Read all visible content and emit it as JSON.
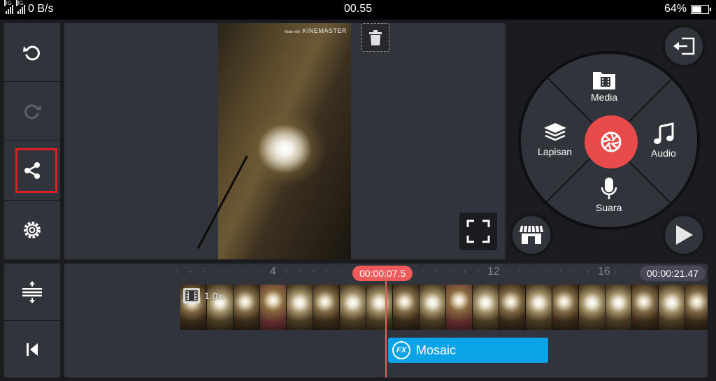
{
  "status_bar": {
    "network_1": "4G",
    "network_2": "3G",
    "speed": "0 B/s",
    "time": "00.55",
    "battery": "64%",
    "battery_level": 0.64
  },
  "left_toolbar": {
    "icons": [
      "undo-icon",
      "redo-icon",
      "share-icon",
      "settings-icon"
    ],
    "highlighted": "share"
  },
  "timeline_tools": {
    "icons": [
      "expand-timeline-icon",
      "skip-to-start-icon"
    ]
  },
  "preview": {
    "watermark_prefix": "Made with",
    "watermark_brand": "KINEMASTER",
    "icons": [
      "trash-icon",
      "fullscreen-icon"
    ]
  },
  "media_wheel": {
    "items": {
      "media": "Media",
      "layer": "Lapisan",
      "audio": "Audio",
      "voice": "Suara"
    },
    "center": "camera-shutter-icon",
    "colors": {
      "record": "#e94b4b",
      "accent_fx": "#0aa3e8"
    }
  },
  "right_controls": {
    "icons": [
      "exit-project-icon",
      "asset-store-icon",
      "play-icon"
    ]
  },
  "timeline": {
    "ruler_labels": [
      "4",
      "12",
      "16"
    ],
    "current_time": "00:00:07.5",
    "total_time": "00:00:21.47",
    "clip_speed": "1.0x",
    "effect_badge": "FX",
    "effect_label": "Mosaic"
  }
}
